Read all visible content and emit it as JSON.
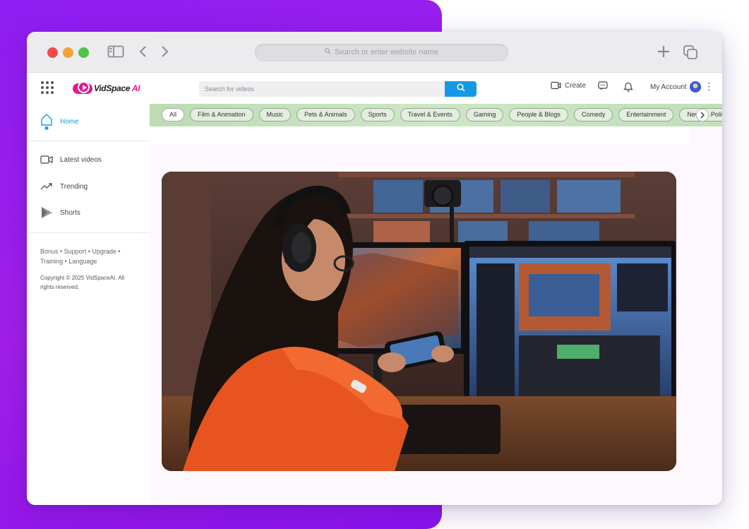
{
  "browser": {
    "url_placeholder": "Search or enter website name"
  },
  "header": {
    "logo_main": "VidSpace",
    "logo_suffix": " AI",
    "search_placeholder": "Search for videos",
    "create_label": "Create",
    "account_label": "My Account"
  },
  "sidebar": {
    "items": [
      {
        "label": "Home",
        "icon": "home-icon",
        "active": true
      },
      {
        "label": "Latest videos",
        "icon": "video-icon"
      },
      {
        "label": "Trending",
        "icon": "trending-icon"
      },
      {
        "label": "Shorts",
        "icon": "shorts-icon"
      }
    ],
    "footer_links": "Bonus • Support • Upgrade • Training • Language",
    "copyright": "Copyright © 2025 VidSpaceAI. All rights reserved."
  },
  "categories": [
    "All",
    "Film & Animation",
    "Music",
    "Pets & Animals",
    "Sports",
    "Travel & Events",
    "Gaming",
    "People & Blogs",
    "Comedy",
    "Entertainment",
    "News & Politics"
  ],
  "colors": {
    "accent": "#1499e4",
    "brand_pink": "#e2168f",
    "category_bar": "#c6e2bd",
    "background_purple": "#9b1ef0"
  }
}
